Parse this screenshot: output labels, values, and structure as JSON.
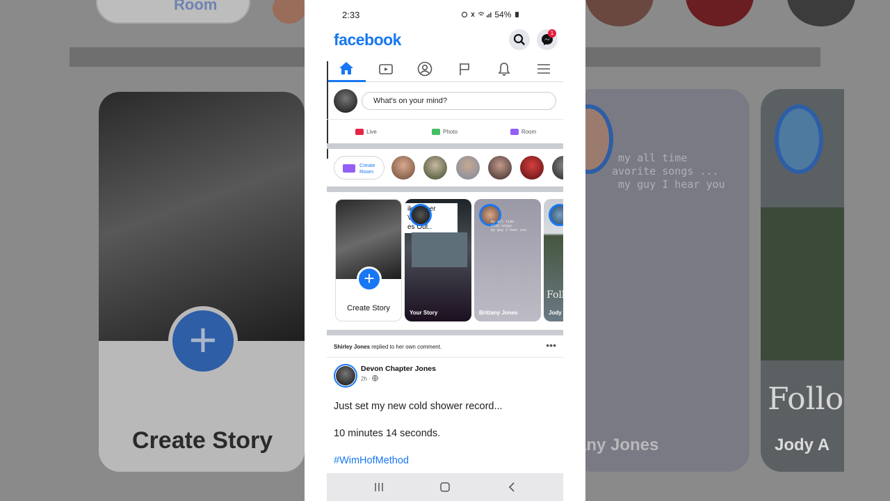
{
  "status": {
    "time": "2:33",
    "battery": "54%"
  },
  "app": {
    "logo": "facebook",
    "messenger_badge": "1"
  },
  "composer": {
    "placeholder": "What's on your mind?"
  },
  "actions": [
    {
      "label": "Live",
      "color": "#e42645"
    },
    {
      "label": "Photo",
      "color": "#45bd62"
    },
    {
      "label": "Room",
      "color": "#9360f7"
    }
  ],
  "rooms": {
    "create_line1": "Create",
    "create_line2": "Room"
  },
  "stories": [
    {
      "label": "Create Story"
    },
    {
      "label": "Your Story",
      "caption": "ike Other Virus,\nes Out.."
    },
    {
      "label": "Brittany Jones",
      "caption": "my all time\nrite songs\nmy guy I hear you"
    },
    {
      "label": "Jody A",
      "caption": "Follo"
    }
  ],
  "background_right": {
    "caption": " my all time\navorite songs ...\n my guy I hear you",
    "name1": "tany Jones",
    "name2": "Jody A",
    "follo": "Follo"
  },
  "background_left": {
    "room_label": "Room",
    "create_story": "Create Story"
  },
  "notification": {
    "actor": "Shirley Jones",
    "text": " replied to her own comment."
  },
  "post": {
    "author": "Devon Chapter Jones",
    "time": "2h",
    "line1": "Just set my new cold shower record...",
    "line2": "10 minutes 14 seconds.",
    "hashtag": "#WimHofMethod"
  },
  "colors": {
    "brand": "#1877f2",
    "divider": "#c9ccd1"
  }
}
